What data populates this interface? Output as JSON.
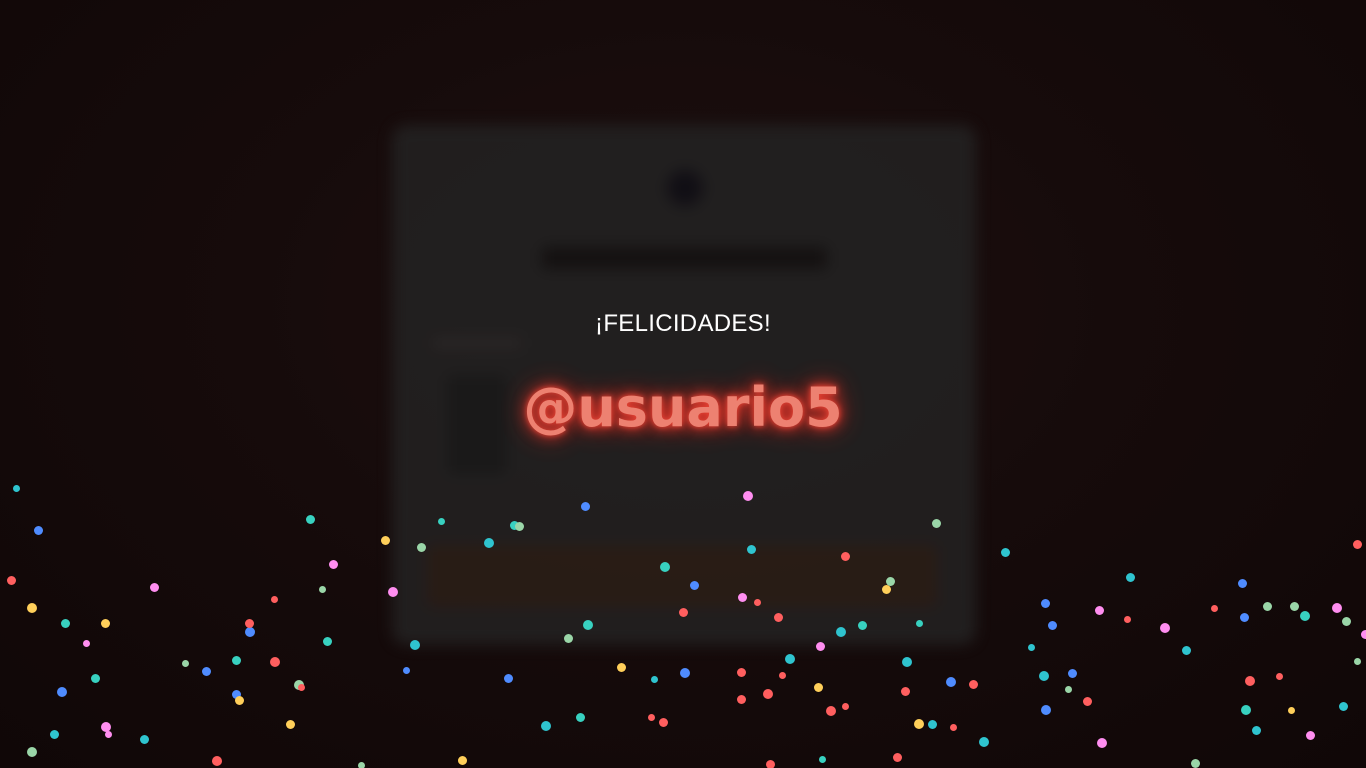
{
  "overlay": {
    "title": "¡FELICIDADES!",
    "username": "@usuario5"
  },
  "colors": {
    "background": "#120909",
    "username_glow": "#ff4a3a",
    "confetti": [
      "#2fc4cf",
      "#4f8cff",
      "#ff5f5f",
      "#ffcf5a",
      "#ff8ef0",
      "#9ad6a8",
      "#38d1c0"
    ]
  }
}
